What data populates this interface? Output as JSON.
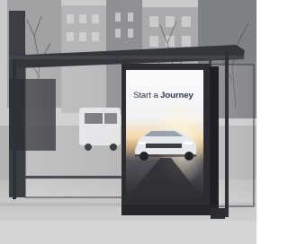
{
  "scene": {
    "description_kind": "photo",
    "ad_headline_prefix": "Start a",
    "ad_headline_emphasis": "Journey"
  },
  "colors": {
    "sky": "#e9eaea",
    "street": "#b6b7b6",
    "sidewalk": "#cfd0cf",
    "shelter_frame": "#2c2f33",
    "ad_sky_top": "#fbfcfd",
    "ad_sunset": "#f3c78d",
    "ad_road": "#3a3b40",
    "car_body": "#e9ecef",
    "headline": "#2a3650"
  }
}
